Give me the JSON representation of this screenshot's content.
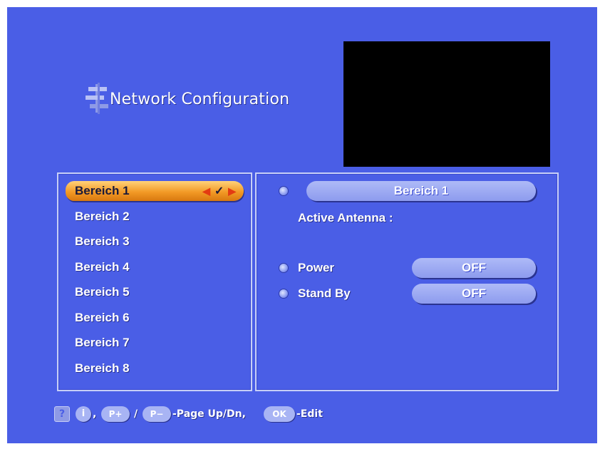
{
  "header": {
    "title": "Network Configuration",
    "icon": "network-icon"
  },
  "areas": {
    "items": [
      {
        "label": "Bereich 1",
        "selected": true
      },
      {
        "label": "Bereich 2",
        "selected": false
      },
      {
        "label": "Bereich 3",
        "selected": false
      },
      {
        "label": "Bereich 4",
        "selected": false
      },
      {
        "label": "Bereich 5",
        "selected": false
      },
      {
        "label": "Bereich 6",
        "selected": false
      },
      {
        "label": "Bereich 7",
        "selected": false
      },
      {
        "label": "Bereich 8",
        "selected": false
      }
    ],
    "selected_marker": "✓"
  },
  "details": {
    "area_name": "Bereich 1",
    "active_antenna_label": "Active Antenna :",
    "power_label": "Power",
    "power_value": "OFF",
    "standby_label": "Stand By",
    "standby_value": "OFF"
  },
  "footer": {
    "help_icon": "?",
    "info_icon": "i",
    "sep1": ",",
    "page_up_btn": "P+",
    "slash": "/",
    "page_down_btn": "P−",
    "page_text": "-Page Up/Dn,",
    "ok_btn": "OK",
    "edit_text": "-Edit"
  },
  "colors": {
    "background": "#4a5ee6",
    "selected_item": "#f29a26",
    "pill": "#9aa8f2",
    "arrow": "#e33b12"
  }
}
